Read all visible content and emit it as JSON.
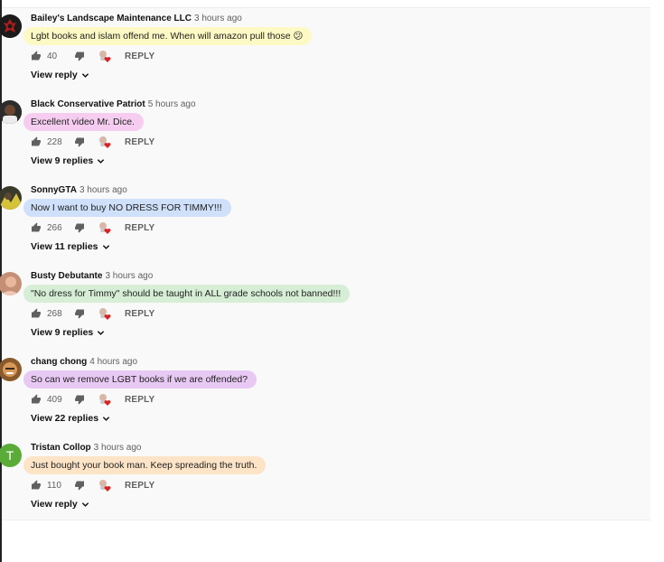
{
  "comments": [
    {
      "author": "Bailey's Landscape Maintenance LLC",
      "time": "3 hours ago",
      "text": "Lgbt books and islam offend me. When will amazon pull those 😕",
      "likes": "40",
      "reply_label": "REPLY",
      "view_replies": "View reply",
      "highlight_color": "#fdf9c4",
      "avatar": "horde-emblem-avatar"
    },
    {
      "author": "Black Conservative Patriot",
      "time": "5 hours ago",
      "text": "Excellent video Mr. Dice.",
      "likes": "228",
      "reply_label": "REPLY",
      "view_replies": "View 9 replies",
      "highlight_color": "#f6cdf0",
      "avatar": "photo-avatar"
    },
    {
      "author": "SonnyGTA",
      "time": "3 hours ago",
      "text": "Now I want to buy NO DRESS FOR TIMMY!!!",
      "likes": "266",
      "reply_label": "REPLY",
      "view_replies": "View 11 replies",
      "highlight_color": "#cfe0fb",
      "avatar": "photo-avatar"
    },
    {
      "author": "Busty Debutante",
      "time": "3 hours ago",
      "text": "\"No dress for Timmy\" should be taught in ALL grade schools not banned!!!",
      "likes": "268",
      "reply_label": "REPLY",
      "view_replies": "View 9 replies",
      "highlight_color": "#d6eed5",
      "avatar": "photo-avatar"
    },
    {
      "author": "chang chong",
      "time": "4 hours ago",
      "text": "So can we remove LGBT books if we are offended?",
      "likes": "409",
      "reply_label": "REPLY",
      "view_replies": "View 22 replies",
      "highlight_color": "#e8c9f4",
      "avatar": "photo-avatar"
    },
    {
      "author": "Tristan Collop",
      "time": "3 hours ago",
      "text": "Just bought your book man. Keep spreading the truth.",
      "likes": "110",
      "reply_label": "REPLY",
      "view_replies": "View reply",
      "highlight_color": "#fde4c7",
      "avatar": "letter-avatar",
      "avatar_letter": "T",
      "avatar_color": "#5bab38"
    }
  ]
}
